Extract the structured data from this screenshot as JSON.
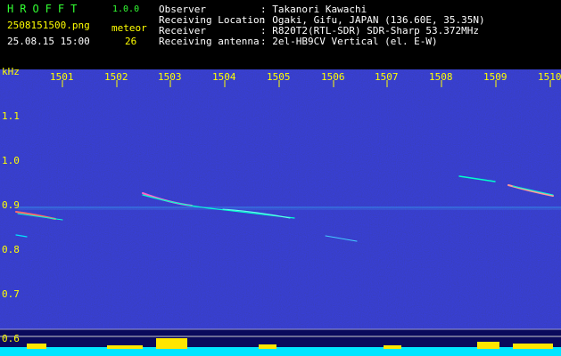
{
  "header": {
    "logo": "HROFFT",
    "version": "1.0.0",
    "filename": "2508151500.png",
    "datetime": "25.08.15 15:00",
    "meteor_label": "meteor",
    "meteor_count": "26",
    "info_labels": [
      "Observer",
      "Receiving Location",
      "Receiver",
      "Receiving antenna"
    ],
    "info_values": [
      ": Takanori Kawachi",
      ": Ogaki, Gifu, JAPAN (136.60E, 35.35N)",
      ": R820T2(RTL-SDR) SDR-Sharp 53.372MHz",
      ": 2el-HB9CV Vertical (el. E-W)"
    ]
  },
  "axes": {
    "y_unit": "kHz",
    "x_ticks": [
      "1501",
      "1502",
      "1503",
      "1504",
      "1505",
      "1506",
      "1507",
      "1508",
      "1509",
      "1510"
    ],
    "y_ticks": [
      "1.1",
      "1.0",
      "0.9",
      "0.8",
      "0.7",
      "0.6"
    ]
  },
  "colors": {
    "background_noise": "#0a0a5c",
    "label_yellow": "#ffff00",
    "label_green": "#33ff33",
    "baseline_cyan": "#00e5ff",
    "baseline_yellow": "#ffe600"
  }
}
